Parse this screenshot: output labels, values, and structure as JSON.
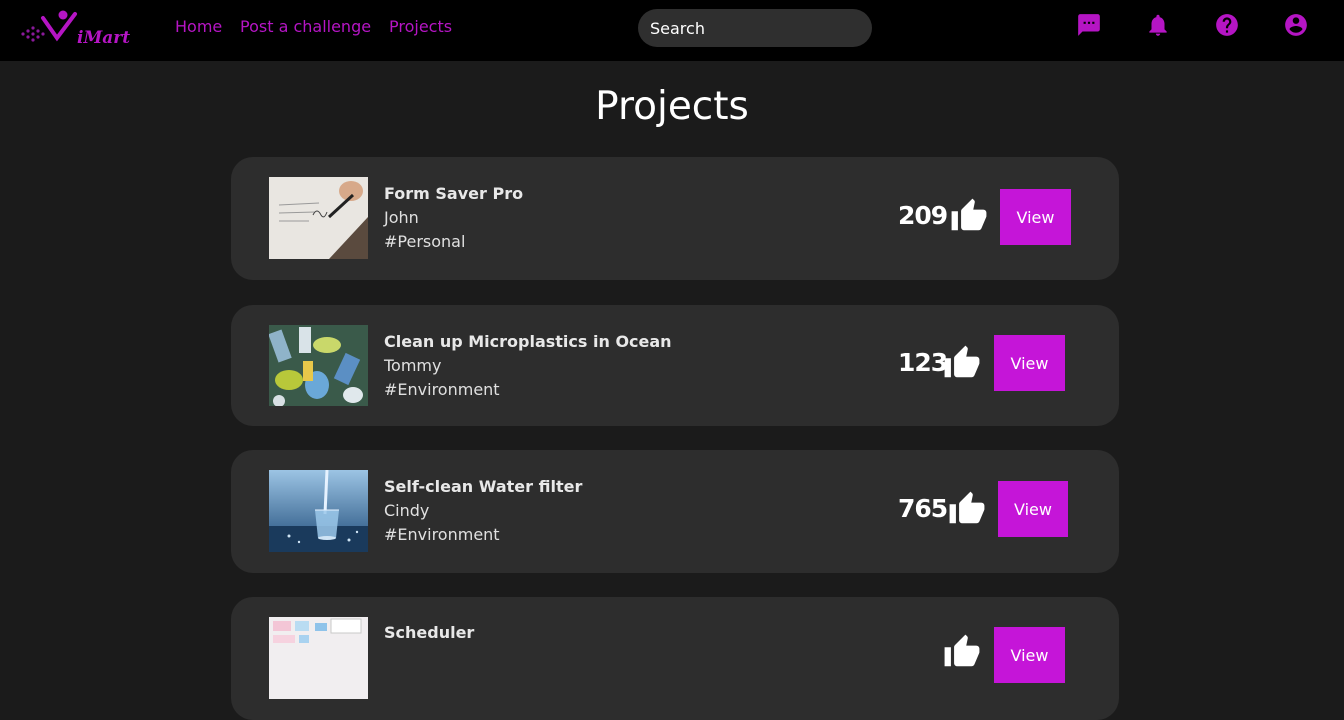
{
  "header": {
    "logo_text": "iMart",
    "nav": [
      "Home",
      "Post a challenge",
      "Projects"
    ],
    "search_placeholder": "Search",
    "icons": [
      "chat-icon",
      "bell-icon",
      "help-icon",
      "account-icon"
    ]
  },
  "page": {
    "title": "Projects"
  },
  "projects": [
    {
      "title": "Form Saver Pro",
      "author": "John",
      "tag": "#Personal",
      "likes": "209",
      "view_label": "View",
      "image": "signing-document"
    },
    {
      "title": "Clean up Microplastics in Ocean",
      "author": "Tommy",
      "tag": "#Environment",
      "likes": "123",
      "view_label": "View",
      "image": "plastic-waste"
    },
    {
      "title": "Self-clean Water filter",
      "author": "Cindy",
      "tag": "#Environment",
      "likes": "765",
      "view_label": "View",
      "image": "water-glass"
    },
    {
      "title": "Scheduler",
      "author": "",
      "tag": "",
      "likes": "",
      "view_label": "View",
      "image": "whiteboard-schedule"
    }
  ],
  "colors": {
    "accent": "#c515d8",
    "nav_link": "#b515c4",
    "background": "#1b1b1b",
    "card": "#2d2d2d",
    "topbar": "#000000"
  }
}
